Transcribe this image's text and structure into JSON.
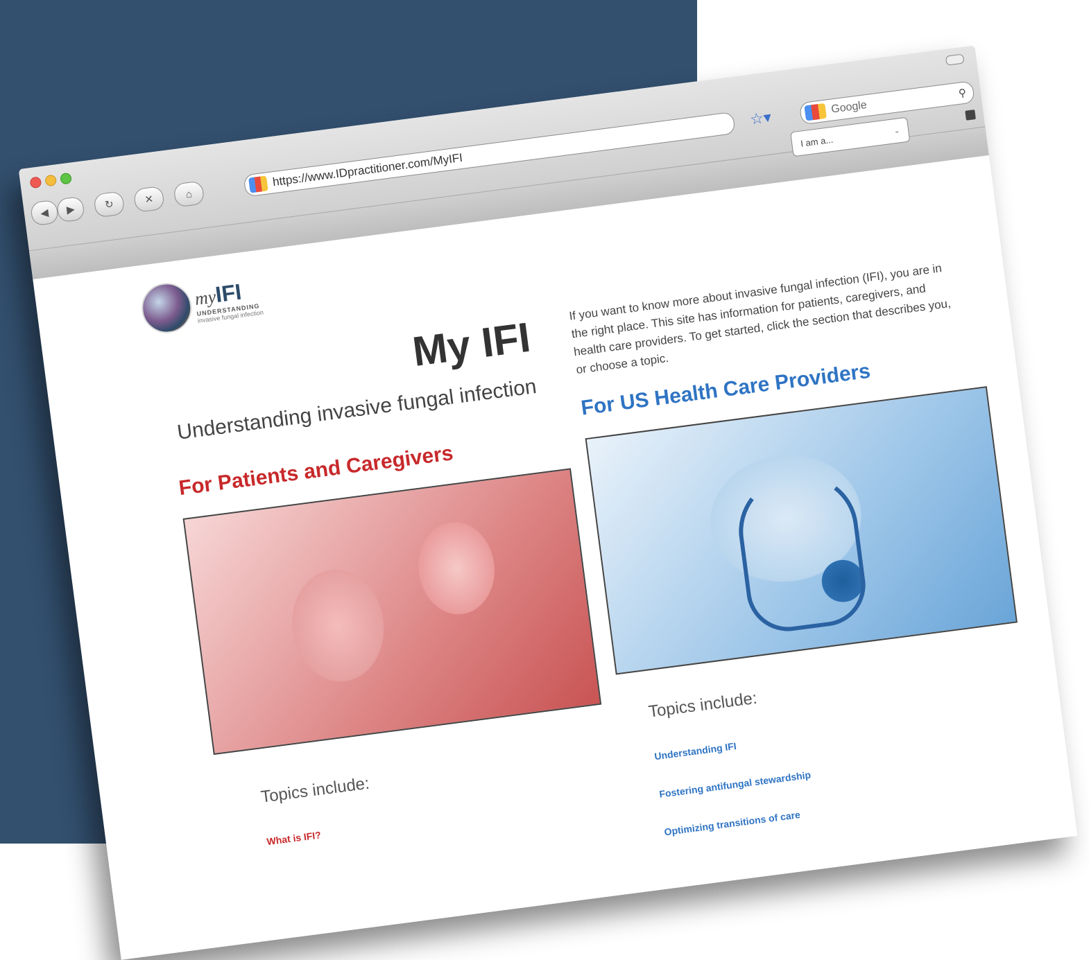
{
  "browser": {
    "url": "https://www.IDpractitioner.com/MyIFI",
    "search_placeholder": "Google",
    "new_tab_label": "+",
    "nav_back": "◀",
    "nav_forward": "▶",
    "nav_reload": "↻",
    "nav_stop": "✕",
    "nav_home": "⌂",
    "star": "☆▾",
    "magnifier": "⚲"
  },
  "site": {
    "logo_word": "my",
    "logo_word_bold": "IFI",
    "logo_sub1": "UNDERSTANDING",
    "logo_sub2": "invasive fungal infection",
    "selector_label": "I am a...",
    "selector_chevron": "⌄",
    "title": "My IFI",
    "subtitle": "Understanding invasive fungal infection",
    "intro": "If you want to know more about invasive fungal infection (IFI), you are in the right place. This site has information for patients, caregivers, and health care providers. To get started, click the section that describes you, or choose a topic."
  },
  "patients": {
    "heading": "For Patients and Caregivers",
    "topics_label": "Topics include:",
    "links": [
      "What is IFI?"
    ]
  },
  "providers": {
    "heading": "For US Health Care Providers",
    "topics_label": "Topics include:",
    "links": [
      "Understanding IFI",
      "Fostering antifungal stewardship",
      "Optimizing transitions of care"
    ]
  },
  "colors": {
    "background_panel": "#33506f",
    "patients_accent": "#c8292b",
    "providers_accent": "#2f74c3"
  }
}
